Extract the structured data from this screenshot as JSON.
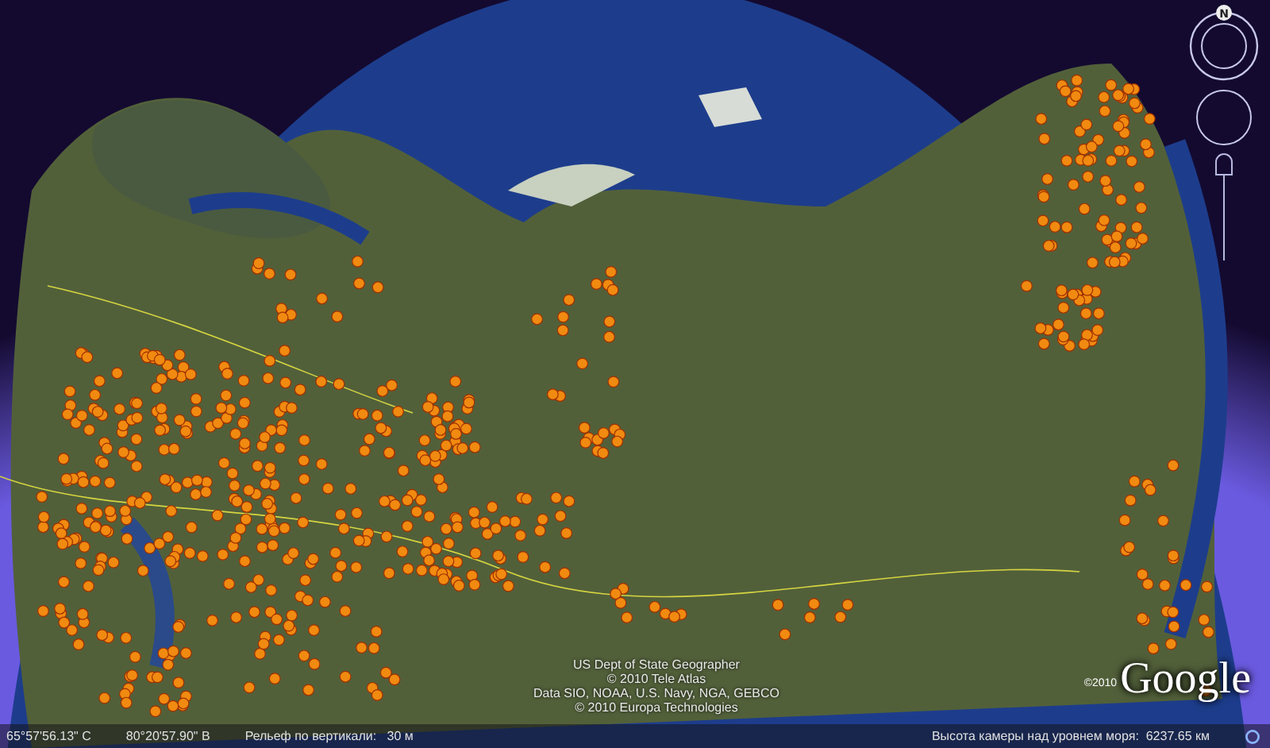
{
  "map": {
    "attribution": [
      "US Dept of State Geographer",
      "© 2010 Tele Atlas",
      "Data SIO, NOAA, U.S. Navy, NGA, GEBCO",
      "© 2010 Europa Technologies"
    ],
    "logo_year": "©2010",
    "logo": "Google"
  },
  "navigation": {
    "compass_label": "N"
  },
  "status_bar": {
    "latitude": "65°57'56.13\" С",
    "longitude": "80°20'57.90\" В",
    "elevation": "Рельеф по вертикали:   30 м",
    "camera_altitude": "Высота камеры над уровнем моря:  6237.65 км"
  }
}
